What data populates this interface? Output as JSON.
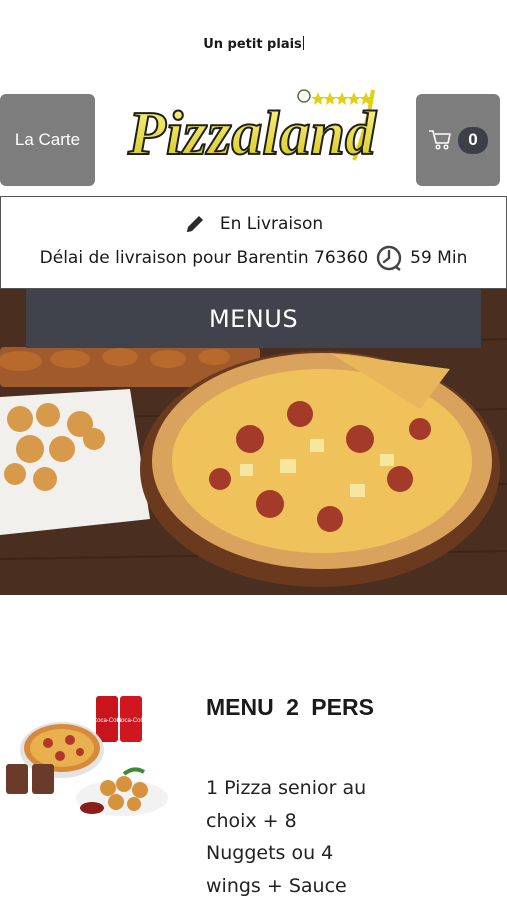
{
  "header": {
    "tagline": "Un petit plais",
    "menu_button_label": "La Carte",
    "cart_count": "0",
    "logo_text": "Pizzaland",
    "logo_stars": 5
  },
  "delivery": {
    "mode_label": "En Livraison",
    "delay_text": "Délai de livraison pour Barentin 76360",
    "delay_value": "59 Min"
  },
  "banner": {
    "title": "MENUS"
  },
  "product": {
    "title": "MENU   2 PERS",
    "description": "1 Pizza senior au\nchoix  + 8\nNuggets ou 4\nwings  + Sauce"
  },
  "icons": {
    "cart": "cart-icon",
    "edit": "pencil-icon",
    "clock": "clock-icon"
  }
}
